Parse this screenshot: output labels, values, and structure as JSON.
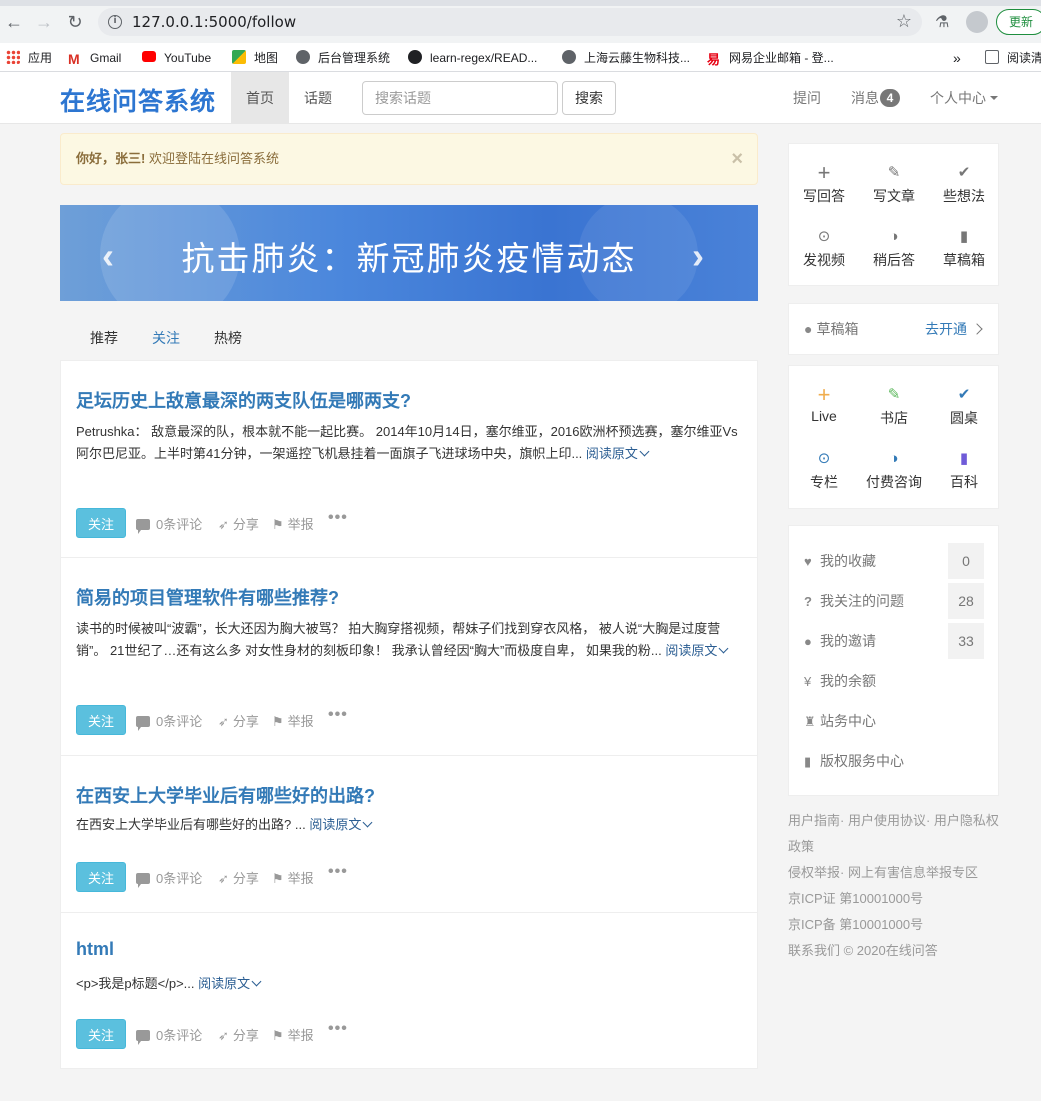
{
  "browser": {
    "url": "127.0.0.1:5000/follow",
    "update_label": "更新"
  },
  "bookmarks": [
    {
      "label": "应用",
      "color": "#4285f4"
    },
    {
      "label": "Gmail",
      "color": "#d93025"
    },
    {
      "label": "YouTube",
      "color": "#ff0000"
    },
    {
      "label": "地图",
      "color": "#34a853"
    },
    {
      "label": "后台管理系统",
      "color": "#5f6368"
    },
    {
      "label": "learn-regex/READ...",
      "color": "#202124"
    },
    {
      "label": "上海云藤生物科技...",
      "color": "#5f6368"
    },
    {
      "label": "网易企业邮箱 - 登...",
      "color": "#e60012"
    },
    {
      "label": "»",
      "color": ""
    },
    {
      "label": "阅读清",
      "color": "#5f6368"
    }
  ],
  "header": {
    "brand": "在线问答系统",
    "nav": [
      {
        "label": "首页",
        "active": true
      },
      {
        "label": "话题",
        "active": false
      }
    ],
    "search_placeholder": "搜索话题",
    "search_button": "搜索",
    "ask": "提问",
    "messages": "消息",
    "messages_count": "4",
    "profile": "个人中心"
  },
  "alert": {
    "greeting": "你好，张三!",
    "message": " 欢迎登陆在线问答系统",
    "close": "×"
  },
  "banner": {
    "text": "抗击肺炎：新冠肺炎疫情动态",
    "prev": "‹",
    "next": "›"
  },
  "feed_tabs": [
    {
      "label": "推荐",
      "active": false
    },
    {
      "label": "关注",
      "active": true
    },
    {
      "label": "热榜",
      "active": false
    }
  ],
  "feed": [
    {
      "title": "足坛历史上敌意最深的两支队伍是哪两支?",
      "body": "Petrushka： 敌意最深的队，根本就不能一起比赛。 2014年10月14日，塞尔维亚，2016欧洲杯预选赛，塞尔维亚Vs阿尔巴尼亚。上半时第41分钟，一架遥控飞机悬挂着一面旗子飞进球场中央，旗帜上印...",
      "read_more": "阅读原文",
      "follow": "关注",
      "comments": "0条评论",
      "share": "分享",
      "report": "举报",
      "more": "•••"
    },
    {
      "title": "简易的项目管理软件有哪些推荐?",
      "body": "读书的时候被叫“波霸”，长大还因为胸大被骂？ 拍大胸穿搭视频，帮妹子们找到穿衣风格， 被人说“大胸是过度营销”。 21世纪了…还有这么多 对女性身材的刻板印象！ 我承认曾经因“胸大”而极度自卑， 如果我的粉...",
      "read_more": "阅读原文",
      "follow": "关注",
      "comments": "0条评论",
      "share": "分享",
      "report": "举报",
      "more": "•••"
    },
    {
      "title": "在西安上大学毕业后有哪些好的出路?",
      "body": "在西安上大学毕业后有哪些好的出路? ...",
      "read_more": "阅读原文",
      "follow": "关注",
      "comments": "0条评论",
      "share": "分享",
      "report": "举报",
      "more": "•••"
    },
    {
      "title": "html",
      "body": "<p>我是p标题</p>...",
      "read_more": "阅读原文",
      "follow": "关注",
      "comments": "0条评论",
      "share": "分享",
      "report": "举报",
      "more": "•••"
    }
  ],
  "sidebar": {
    "create": [
      {
        "label": "写回答",
        "icon": "plus-icon",
        "glyph": "+"
      },
      {
        "label": "写文章",
        "icon": "pencil-icon",
        "glyph": "✎"
      },
      {
        "label": "些想法",
        "icon": "check-icon",
        "glyph": "✔"
      },
      {
        "label": "发视频",
        "icon": "play-circle-icon",
        "glyph": "⊙"
      },
      {
        "label": "稍后答",
        "icon": "half-circle-icon",
        "glyph": "◑"
      },
      {
        "label": "草稿箱",
        "icon": "file-icon",
        "glyph": "▮"
      }
    ],
    "drafts_label": "草稿箱",
    "drafts_link": "去开通",
    "services": [
      {
        "label": "Live",
        "icon": "plus-icon",
        "glyph": "+",
        "color": "#f0ad4e"
      },
      {
        "label": "书店",
        "icon": "pencil-icon",
        "glyph": "✎",
        "color": "#5cb85c"
      },
      {
        "label": "圆桌",
        "icon": "check-icon",
        "glyph": "✔",
        "color": "#337ab7"
      },
      {
        "label": "专栏",
        "icon": "play-circle-icon",
        "glyph": "⊙",
        "color": "#337ab7"
      },
      {
        "label": "付费咨询",
        "icon": "half-circle-icon",
        "glyph": "◑",
        "color": "#337ab7"
      },
      {
        "label": "百科",
        "icon": "file-icon",
        "glyph": "▮",
        "color": "#6f5bd8"
      }
    ],
    "stats": [
      {
        "label": "我的收藏",
        "icon": "heart-icon",
        "glyph": "♥",
        "count": "0"
      },
      {
        "label": "我关注的问题",
        "icon": "question-circle-icon",
        "glyph": "?",
        "count": "28"
      },
      {
        "label": "我的邀请",
        "icon": "user-icon",
        "glyph": "●",
        "count": "33"
      },
      {
        "label": "我的余额",
        "icon": "yen-icon",
        "glyph": "¥",
        "count": ""
      },
      {
        "label": "站务中心",
        "icon": "tower-icon",
        "glyph": "♜",
        "count": ""
      },
      {
        "label": "版权服务中心",
        "icon": "file-icon",
        "glyph": "▮",
        "count": ""
      }
    ]
  },
  "footer": {
    "line1": "用户指南· 用户使用协议· 用户隐私权政策",
    "line2": "侵权举报· 网上有害信息举报专区",
    "line3": "京ICP证 第10001000号",
    "line4": "京ICP备 第10001000号",
    "line5": "联系我们 © 2020在线问答"
  },
  "colors": {
    "brand": "#2d76d1",
    "link": "#337ab7",
    "follow_button": "#5bc0de",
    "alert_bg": "#fcf8e3"
  }
}
